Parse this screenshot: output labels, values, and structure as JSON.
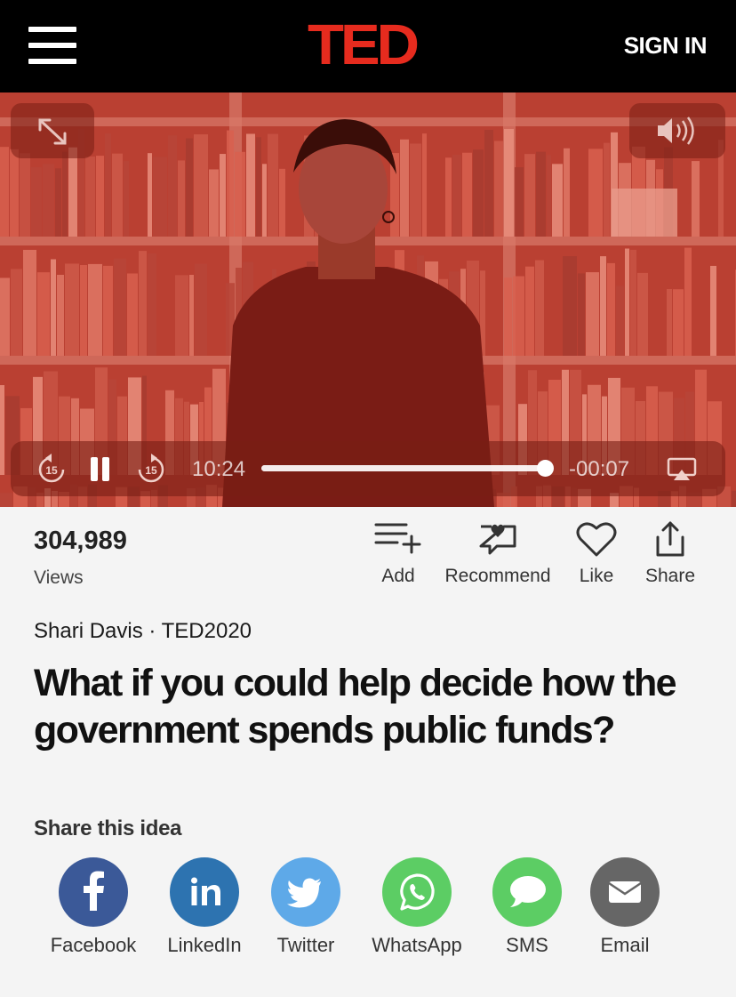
{
  "header": {
    "logo_text": "TED",
    "signin_label": "SIGN IN"
  },
  "player": {
    "elapsed": "10:24",
    "remaining": "-00:07",
    "progress_fraction": 0.985,
    "skip_back_seconds": "15",
    "skip_forward_seconds": "15"
  },
  "stats": {
    "views_count": "304,989",
    "views_label": "Views"
  },
  "actions": [
    {
      "label": "Add",
      "icon": "add-to-list-icon"
    },
    {
      "label": "Recommend",
      "icon": "recommend-icon"
    },
    {
      "label": "Like",
      "icon": "heart-icon"
    },
    {
      "label": "Share",
      "icon": "share-icon"
    }
  ],
  "talk": {
    "speaker": "Shari Davis",
    "separator": "·",
    "event": "TED2020",
    "title": "What if you could help decide how the government spends public funds?"
  },
  "share": {
    "heading": "Share this idea",
    "items": [
      {
        "label": "Facebook",
        "icon": "facebook-icon",
        "color": "#3b5998"
      },
      {
        "label": "LinkedIn",
        "icon": "linkedin-icon",
        "color": "#2d73b0"
      },
      {
        "label": "Twitter",
        "icon": "twitter-icon",
        "color": "#5ea9e8"
      },
      {
        "label": "WhatsApp",
        "icon": "whatsapp-icon",
        "color": "#5ccd64"
      },
      {
        "label": "SMS",
        "icon": "sms-icon",
        "color": "#5ccd64"
      },
      {
        "label": "Email",
        "icon": "email-icon",
        "color": "#666666"
      }
    ]
  },
  "colors": {
    "brand_red": "#e62b1e",
    "video_tint": "#b83a2e"
  }
}
